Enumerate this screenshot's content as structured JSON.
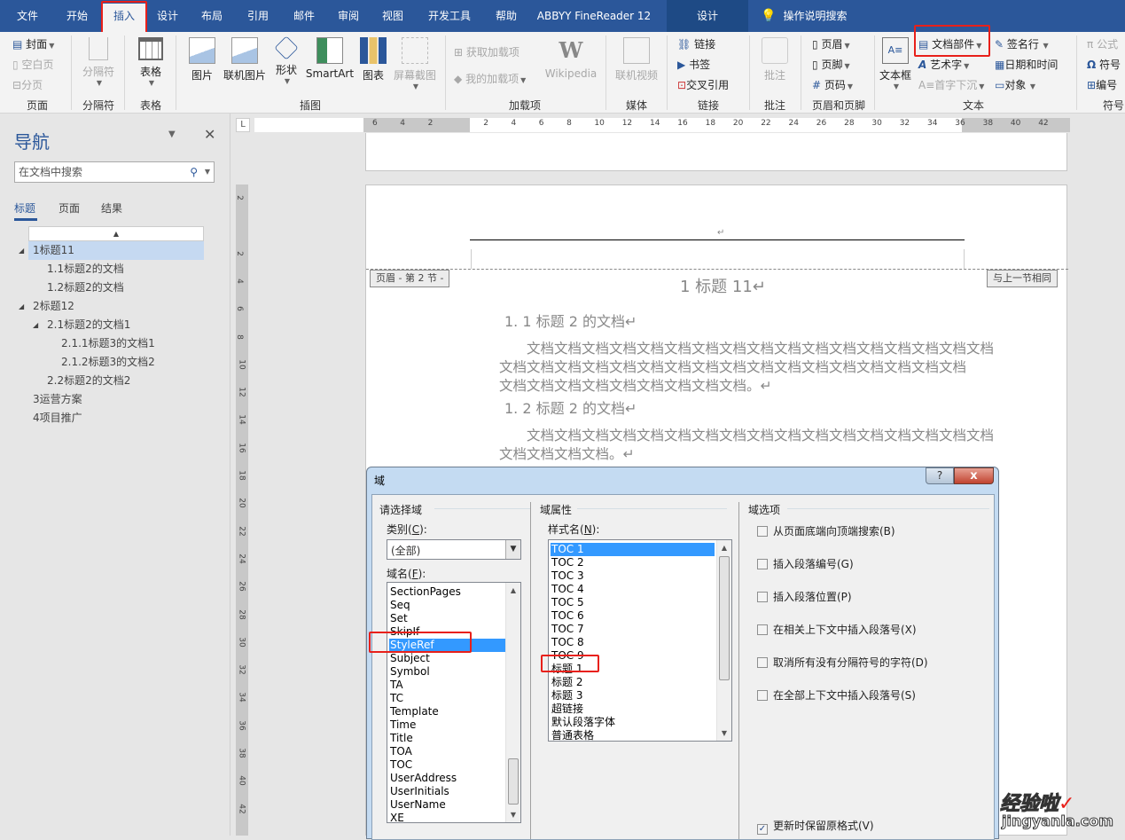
{
  "menubar": {
    "tabs": [
      "文件",
      "开始",
      "插入",
      "设计",
      "布局",
      "引用",
      "邮件",
      "审阅",
      "视图",
      "开发工具",
      "帮助",
      "ABBYY FineReader 12",
      "设计"
    ],
    "active_tab": "插入",
    "search_hint": "操作说明搜索"
  },
  "ribbon": {
    "page_group": {
      "label": "页面",
      "cover": "封面",
      "blank": "空白页",
      "break": "分页"
    },
    "break_group": {
      "label": "分隔符",
      "btn": "分隔符"
    },
    "table_group": {
      "label": "表格",
      "btn": "表格"
    },
    "illustrations": {
      "label": "插图",
      "picture": "图片",
      "online_picture": "联机图片",
      "shapes": "形状",
      "smartart": "SmartArt",
      "chart": "图表",
      "screenshot": "屏幕截图"
    },
    "addins": {
      "label": "加载项",
      "get": "获取加载项",
      "my": "我的加载项",
      "wikipedia": "Wikipedia"
    },
    "media": {
      "label": "媒体",
      "online_video": "联机视频"
    },
    "links": {
      "label": "链接",
      "link": "链接",
      "bookmark": "书签",
      "crossref": "交叉引用"
    },
    "comments": {
      "label": "批注",
      "comment": "批注"
    },
    "header_footer": {
      "label": "页眉和页脚",
      "header": "页眉",
      "footer": "页脚",
      "page_number": "页码"
    },
    "text": {
      "label": "文本",
      "textbox": "文本框",
      "quickparts": "文档部件",
      "wordart": "艺术字",
      "dropcap": "首字下沉",
      "signature": "签名行",
      "datetime": "日期和时间",
      "object": "对象"
    },
    "symbols": {
      "label": "符号",
      "equation": "公式",
      "symbol": "符号",
      "number": "编号"
    }
  },
  "nav": {
    "title": "导航",
    "search_placeholder": "在文档中搜索",
    "tabs": [
      "标题",
      "页面",
      "结果"
    ],
    "active_tab": "标题",
    "tree": [
      {
        "label": "1标题11",
        "level": 0,
        "expanded": true,
        "selected": true
      },
      {
        "label": "1.1标题2的文档",
        "level": 1
      },
      {
        "label": "1.2标题2的文档",
        "level": 1
      },
      {
        "label": "2标题12",
        "level": 0,
        "expanded": true
      },
      {
        "label": "2.1标题2的文档1",
        "level": 1,
        "expanded": true
      },
      {
        "label": "2.1.1标题3的文档1",
        "level": 2
      },
      {
        "label": "2.1.2标题3的文档2",
        "level": 2
      },
      {
        "label": "2.2标题2的文档2",
        "level": 1
      },
      {
        "label": "3运营方案",
        "level": 0
      },
      {
        "label": "4项目推广",
        "level": 0
      }
    ]
  },
  "ruler": {
    "h_ticks": [
      "6",
      "4",
      "2",
      "",
      "2",
      "4",
      "6",
      "8",
      "10",
      "12",
      "14",
      "16",
      "18",
      "20",
      "22",
      "24",
      "26",
      "28",
      "30",
      "32",
      "34",
      "36",
      "38",
      "40",
      "42"
    ],
    "v_ticks": [
      "2",
      "",
      "2",
      "4",
      "6",
      "8",
      "10",
      "12",
      "14",
      "16",
      "18",
      "20",
      "22",
      "24",
      "26",
      "28",
      "30",
      "32",
      "34",
      "36",
      "38",
      "40",
      "42"
    ]
  },
  "document": {
    "header_tag": "页眉 - 第 2 节 -",
    "same_as_prev": "与上一节相同",
    "heading1": "1 标题 11↵",
    "heading2a": "1. 1 标题 2 的文档↵",
    "para1": [
      "文档文档文档文档文档文档文档文档文档文档文档文档文档文档文档文档文档",
      "文档文档文档文档文档文档文档文档文档文档文档文档文档文档文档文档文档",
      "文档文档文档文档文档文档文档文档文档。↵"
    ],
    "heading2b": "1. 2 标题 2 的文档↵",
    "para2": [
      "文档文档文档文档文档文档文档文档文档文档文档文档文档文档文档文档文档",
      "文档文档文档文档。↵"
    ]
  },
  "dialog": {
    "title": "域",
    "help": "?",
    "close": "x",
    "choose_section": "请选择域",
    "category_label": "类别(C):",
    "category_value": "(全部)",
    "fieldname_label": "域名(F):",
    "field_names": [
      "SectionPages",
      "Seq",
      "Set",
      "SkipIf",
      "StyleRef",
      "Subject",
      "Symbol",
      "TA",
      "TC",
      "Template",
      "Time",
      "Title",
      "TOA",
      "TOC",
      "UserAddress",
      "UserInitials",
      "UserName",
      "XE"
    ],
    "field_selected": "StyleRef",
    "props_section": "域属性",
    "stylename_label": "样式名(N):",
    "style_names": [
      "TOC 1",
      "TOC 2",
      "TOC 3",
      "TOC 4",
      "TOC 5",
      "TOC 6",
      "TOC 7",
      "TOC 8",
      "TOC 9",
      "标题 1",
      "标题 2",
      "标题 3",
      "超链接",
      "默认段落字体",
      "普通表格"
    ],
    "style_selected": "TOC 1",
    "options_section": "域选项",
    "options": [
      {
        "label": "从页面底端向顶端搜索(B)",
        "checked": false
      },
      {
        "label": "插入段落编号(G)",
        "checked": false
      },
      {
        "label": "插入段落位置(P)",
        "checked": false
      },
      {
        "label": "在相关上下文中插入段落号(X)",
        "checked": false
      },
      {
        "label": "取消所有没有分隔符号的字符(D)",
        "checked": false
      },
      {
        "label": "在全部上下文中插入段落号(S)",
        "checked": false
      }
    ],
    "preserve": {
      "label": "更新时保留原格式(V)",
      "checked": true
    }
  },
  "watermark": {
    "line1": "经验啦",
    "line2": "jingyanla.com"
  }
}
